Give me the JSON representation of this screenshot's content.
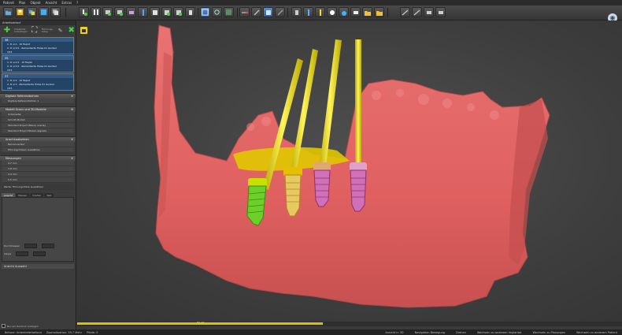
{
  "menu": [
    "Patient",
    "Plan",
    "Objekt",
    "Ansicht",
    "Extras",
    "?"
  ],
  "toolbar_icons": [
    "open-icon",
    "save-icon",
    "reload-icon",
    "screenshot-icon",
    "implant-add-icon",
    "implant-list-icon",
    "sleeve-icon",
    "anchor-pin-icon",
    "guide-icon",
    "bone-icon",
    "crown-icon",
    "nerve-icon",
    "slice-icon",
    "cut-icon",
    "view-icon",
    "fit-icon",
    "axis-icon",
    "pointer-icon",
    "zoom-icon",
    "pan-icon",
    "rotate-icon",
    "measure-icon",
    "sound-icon",
    "snapshot-icon",
    "folder-icon",
    "lock-icon",
    "scan-icon",
    "ruler-icon",
    "print-icon",
    "export-icon"
  ],
  "left_panel": {
    "header": "Arbeitsablauf",
    "tool_labels": [
      "Implantat",
      "hinzufügen",
      "Führungs-",
      "hülse"
    ],
    "plans": [
      {
        "title": "36",
        "rows": [
          "1. R: ø 4 · 10 Faqist",
          "2. R: ø 3,5 · Zementierte Hülse 01 Guided",
          "Y.P.5"
        ]
      },
      {
        "title": "35",
        "rows": [
          "1. R: ø 4,5 · 10 Faqist",
          "2. R: ø 3,5 · Zementierte Hülse 01 Guided",
          "Y.P.5"
        ]
      },
      {
        "title": "37",
        "rows": [
          "1. R: ø 4 · 10 Faqist",
          "2. R: ø 3 · Zementierte Hülse 01 Guided",
          "Y.P.5"
        ]
      }
    ],
    "sections": [
      {
        "title": "Digitale Referenzbohren",
        "rows": [
          "Digitale Referenzbohren 1"
        ]
      },
      {
        "title": "Modell-Scans und 3D-Modelle",
        "rows": [
          "Unterkiefer",
          "Schnitt-Modell",
          "Standard Project Waxup overlay",
          "Standard Project Modell upgrade"
        ]
      },
      {
        "title": "Anschlussbohren",
        "rows": [
          "Nervenverlauf",
          "Führungshülsen auswählen"
        ]
      },
      {
        "title": "Messungen",
        "rows": [
          "4,7 mm",
          "3,8 mm",
          "4,4 mm",
          "5,5 mm"
        ]
      }
    ],
    "info_text": "Werte: Führungshülse auswählen",
    "tabs": [
      "Ansicht",
      "Messen",
      "Drehen",
      "Text"
    ],
    "prop_rows": [
      {
        "label": "Durchmesser"
      },
      {
        "label": "Länge"
      }
    ],
    "extra_header": "Ansicht Auswahl",
    "checkbox_label": "Nur am Zentrum anzeigen",
    "bottom_value": "0 mm",
    "bottom_value2": "0,0 mm"
  },
  "scroll_label": "50 µm",
  "status": {
    "left": [
      "Befund: Unterkieferbefund",
      "Zoomsituation: 59.7 Mehr",
      "Pfade: 0"
    ],
    "right": [
      "Ansicht in 3D",
      "Navigation Bewegung",
      "Drehen",
      "Wechseln zu anderem Implantat",
      "Wechseln zu Planungen",
      "Wechseln zu anderem Patient"
    ]
  }
}
